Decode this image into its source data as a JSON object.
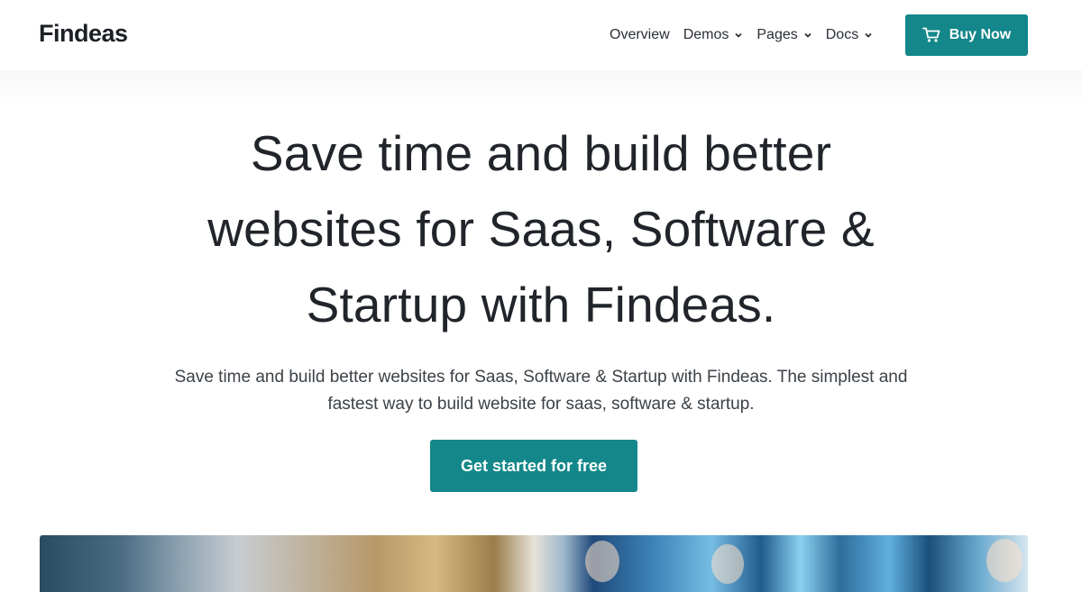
{
  "header": {
    "logo": "Findeas",
    "nav": [
      {
        "label": "Overview",
        "has_dropdown": false
      },
      {
        "label": "Demos",
        "has_dropdown": true
      },
      {
        "label": "Pages",
        "has_dropdown": true
      },
      {
        "label": "Docs",
        "has_dropdown": true
      }
    ],
    "buy_button": {
      "label": "Buy Now",
      "icon": "cart-icon"
    }
  },
  "hero": {
    "title_lines": [
      "Save time and build better",
      "websites for Saas, Software &",
      "Startup with Findeas."
    ],
    "subtitle_lines": [
      "Save time and build better websites for Saas, Software & Startup with Findeas. The simplest and",
      "fastest way to build website for saas, software & startup."
    ],
    "cta_label": "Get started for free"
  },
  "colors": {
    "accent": "#13878a",
    "text": "#21252b",
    "muted": "#3c4248"
  }
}
